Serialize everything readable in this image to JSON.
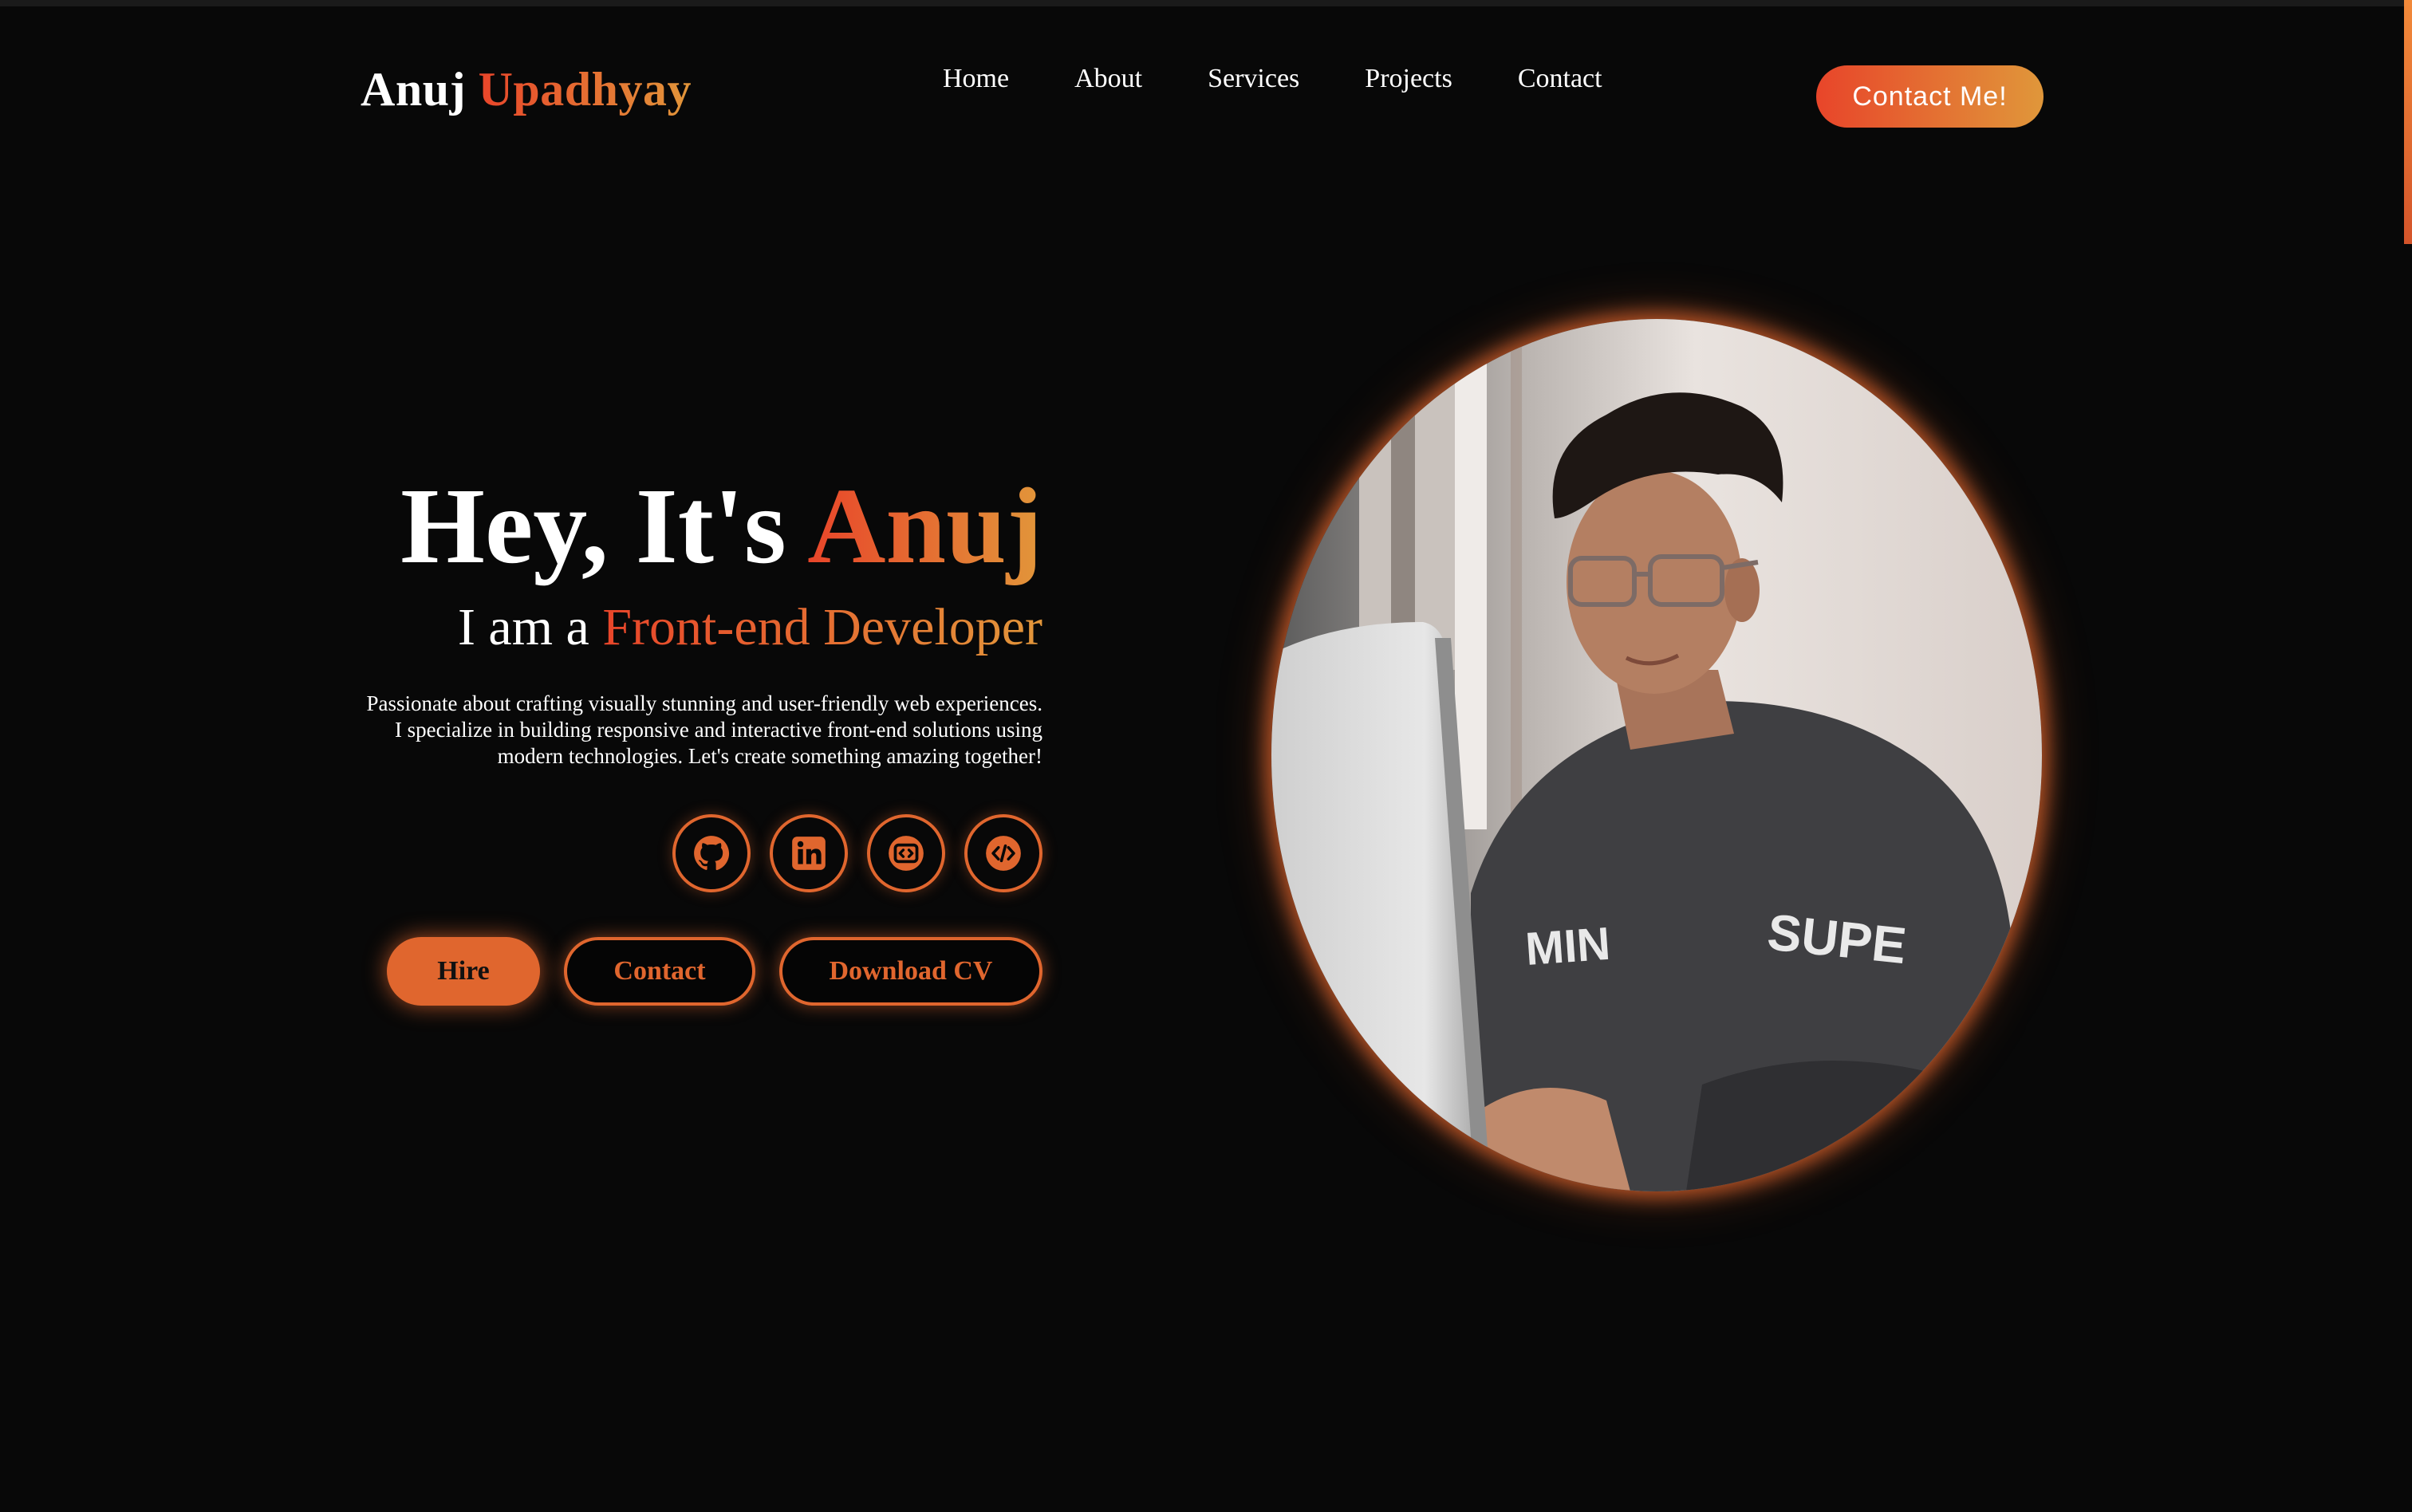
{
  "header": {
    "logo_first": "Anuj",
    "logo_last": "Upadhyay",
    "nav": [
      {
        "label": "Home"
      },
      {
        "label": "About"
      },
      {
        "label": "Services"
      },
      {
        "label": "Projects"
      },
      {
        "label": "Contact"
      }
    ],
    "cta_label": "Contact Me!"
  },
  "hero": {
    "greeting_prefix": "Hey, It's",
    "greeting_name": "Anuj",
    "role_prefix": "I am a",
    "role": "Front-end Developer",
    "bio": "Passionate about crafting visually stunning and user-friendly web experiences. I specialize in building responsive and interactive front-end solutions using modern technologies. Let's create something amazing together!",
    "socials": [
      {
        "icon": "github-icon"
      },
      {
        "icon": "linkedin-icon"
      },
      {
        "icon": "codepen-icon"
      },
      {
        "icon": "code-icon"
      }
    ],
    "buttons": {
      "hire": "Hire",
      "contact": "Contact",
      "download_cv": "Download CV"
    }
  },
  "colors": {
    "background": "#080808",
    "accent": "#e0662e",
    "gradient_start": "#e8452a",
    "gradient_end": "#e2963a",
    "text": "#ffffff"
  }
}
